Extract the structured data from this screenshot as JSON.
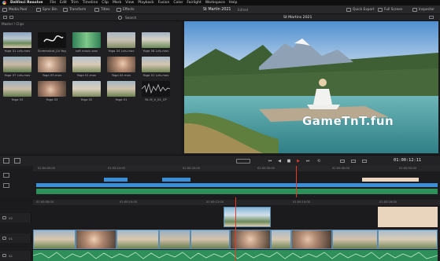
{
  "menubar": {
    "app_name": "DaVinci Resolve",
    "items": [
      "File",
      "Edit",
      "Trim",
      "Timeline",
      "Clip",
      "Mark",
      "View",
      "Playback",
      "Fusion",
      "Color",
      "Fairlight",
      "Workspace",
      "Help"
    ]
  },
  "toolbar": {
    "media_pool": "Media Pool",
    "sync_bin": "Sync Bin",
    "transform": "Transform",
    "titles": "Titles",
    "effects": "Effects",
    "project_title": "St Martin 2021",
    "edited_label": "Edited",
    "timeline_title": "St Martins 2021",
    "quick_export": "Quick Export",
    "full_screen": "Full Screen",
    "inspector": "Inspector"
  },
  "subbar": {
    "search": "Search"
  },
  "pool": {
    "header": "Master / Clips",
    "clips": [
      {
        "label": "Yoga 01 Lvls.mov"
      },
      {
        "label": "Screenshot_04 Yoga.mov"
      },
      {
        "label": "soft music.wav"
      },
      {
        "label": "Yoga 04 Lvls.mov"
      },
      {
        "label": "Yoga 06 Lvls.mov"
      },
      {
        "label": "Yoga 07 Lvls.mov"
      },
      {
        "label": "Yoga 05.mov"
      },
      {
        "label": "Yoga 01.mov"
      },
      {
        "label": "Yoga 04.mov"
      },
      {
        "label": "Yoga 01 Lvls.mov"
      },
      {
        "label": "Yoga 03"
      },
      {
        "label": "Yoga 03"
      },
      {
        "label": "Yoga 02"
      },
      {
        "label": "Yoga 01"
      },
      {
        "label": "RL M_V_01_CP"
      }
    ]
  },
  "viewer": {
    "watermark": "GameTnT.fun"
  },
  "transport": {
    "timecode": "01:00:12:11"
  },
  "timeline": {
    "upper_ruler": [
      "01:00:00:00",
      "01:00:10:00",
      "01:00:20:00",
      "01:00:30:00",
      "01:00:40:00",
      "01:00:50:00"
    ],
    "lower_ruler": [
      "01:00:08:00",
      "01:00:10:00",
      "01:00:12:00",
      "01:00:14:00",
      "01:00:16:00"
    ],
    "tracks": [
      "V2",
      "V1",
      "A1"
    ]
  },
  "colors": {
    "accent_blue": "#3b8fd8",
    "playhead": "#e23b2e",
    "audio_green": "#2f8f5a",
    "title_peach": "#e9d4bd"
  }
}
